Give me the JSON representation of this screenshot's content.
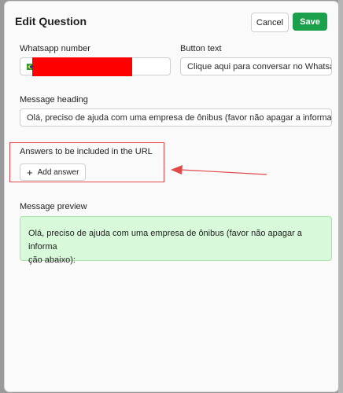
{
  "dialog": {
    "title": "Edit Question",
    "cancel_label": "Cancel",
    "save_label": "Save"
  },
  "form": {
    "whatsapp_label": "Whatsapp number",
    "button_text_label": "Button text",
    "button_text_value": "Clique aqui para conversar no Whatsa",
    "message_heading_label": "Message heading",
    "message_heading_value": "Olá, preciso de ajuda com uma empresa de ônibus (favor não apagar a informaçã",
    "answers_label": "Answers to be included in the URL",
    "add_answer_label": "Add answer",
    "preview_label": "Message preview",
    "preview_line1": "Olá, preciso de ajuda com uma empresa de ônibus (favor não apagar a informa",
    "preview_line2": "ção abaixo):"
  },
  "colors": {
    "save_button": "#1aa04a",
    "highlight_box": "#e0484a",
    "arrow": "#e0484a",
    "preview_bg": "#d9f9db",
    "redaction": "#ff0000"
  },
  "icons": {
    "country_flag": "brazil-flag-icon",
    "add": "plus-icon"
  }
}
